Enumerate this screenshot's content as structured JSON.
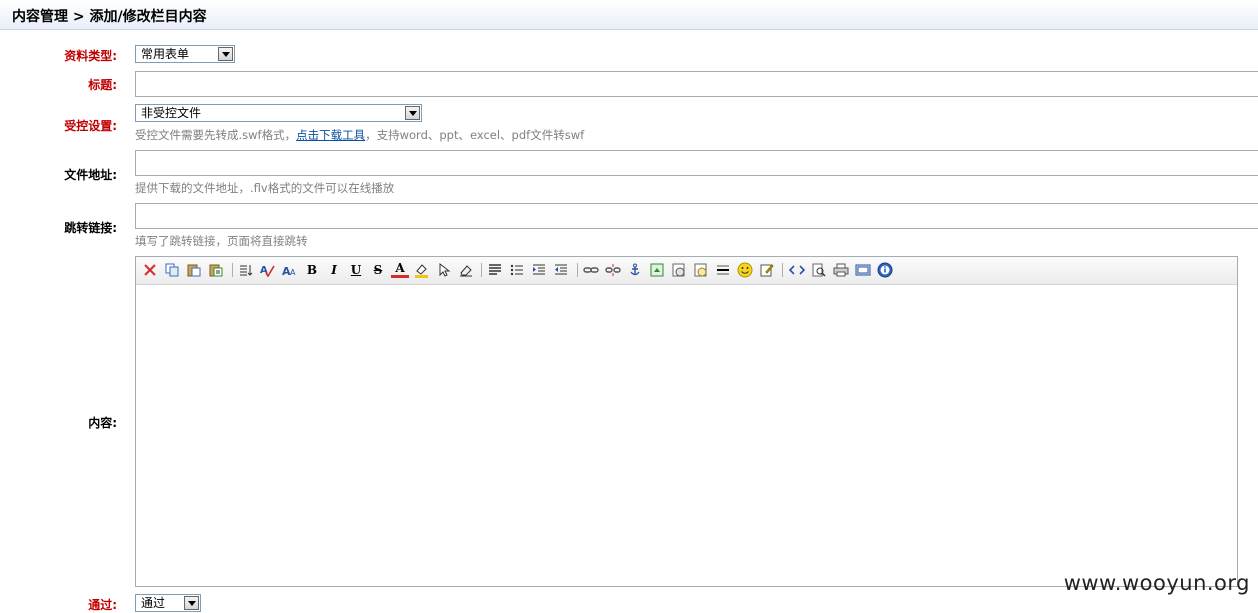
{
  "breadcrumb": "内容管理 > 添加/修改栏目内容",
  "fields": {
    "type_label": "资料类型:",
    "type_value": "常用表单",
    "title_label": "标题:",
    "title_value": "",
    "control_label": "受控设置:",
    "control_value": "非受控文件",
    "control_hint_before": "受控文件需要先转成.swf格式，",
    "control_hint_link": "点击下载工具",
    "control_hint_after": "，支持word、ppt、excel、pdf文件转swf",
    "file_label": "文件地址:",
    "file_value": "",
    "file_hint": "提供下载的文件地址，.flv格式的文件可以在线播放",
    "redirect_label": "跳转链接:",
    "redirect_value": "",
    "redirect_hint": "填写了跳转链接，页面将直接跳转",
    "content_label": "内容:",
    "approve_label": "通过:",
    "approve_value": "通过"
  },
  "toolbar": {
    "bold": "B",
    "italic": "I",
    "underline": "U",
    "strike": "S",
    "font_color": "A",
    "icons": [
      "cut-icon",
      "copy-icon",
      "paste-icon",
      "paste-text-icon",
      "format-block-icon",
      "spellcheck-icon",
      "font-size-icon",
      "bold-icon",
      "italic-icon",
      "underline-icon",
      "strikethrough-icon",
      "font-color-icon",
      "highlight-icon",
      "select-all-icon",
      "eraser-icon",
      "align-icon",
      "list-icon",
      "indent-icon",
      "outdent-icon",
      "link-icon",
      "unlink-icon",
      "anchor-icon",
      "image-icon",
      "flash-icon",
      "media-icon",
      "horizontal-rule-icon",
      "emoticon-icon",
      "edit-icon",
      "source-icon",
      "preview-icon",
      "print-icon",
      "fullscreen-icon",
      "about-icon"
    ]
  },
  "watermark": "www.wooyun.org"
}
